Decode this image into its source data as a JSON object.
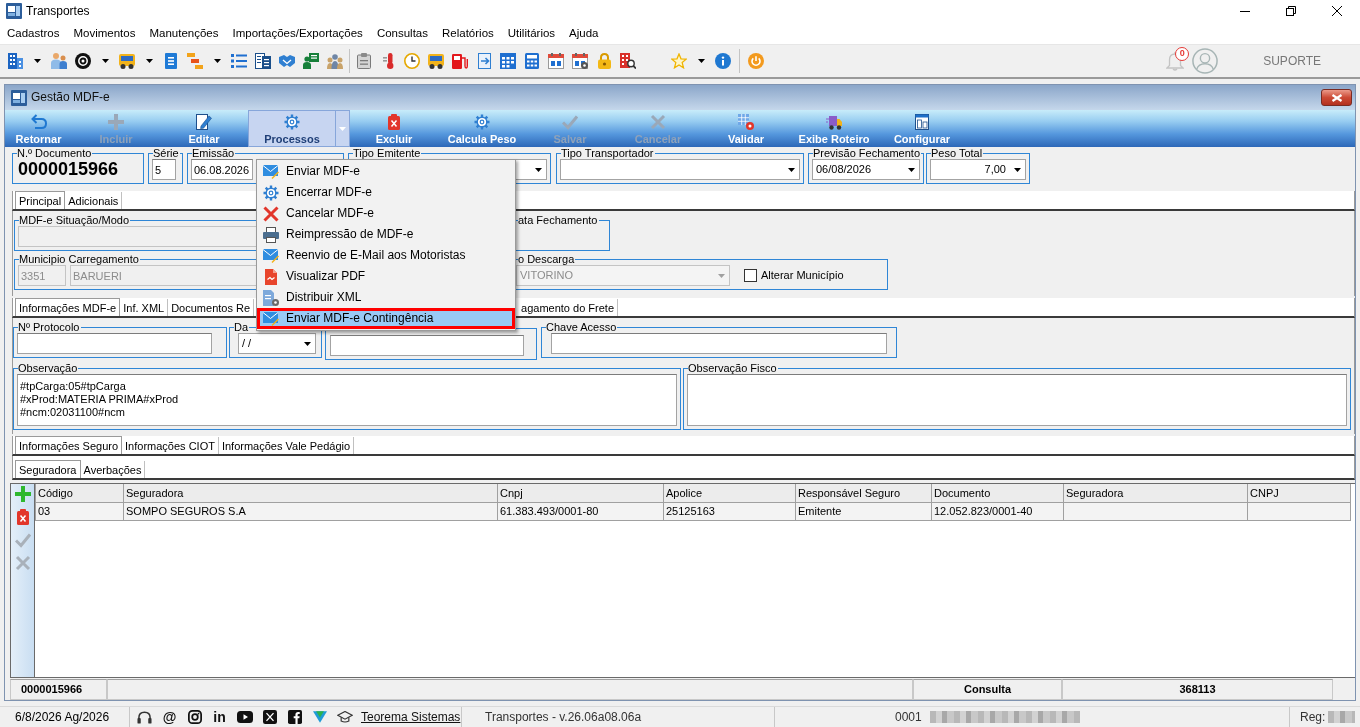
{
  "window": {
    "title": "Transportes"
  },
  "menu": [
    "Cadastros",
    "Movimentos",
    "Manutenções",
    "Importações/Exportações",
    "Consultas",
    "Relatórios",
    "Utilitários",
    "Ajuda"
  ],
  "header": {
    "notifications": "0",
    "user": "SUPORTE"
  },
  "form": {
    "title": "Gestão MDF-e"
  },
  "ribbon": [
    {
      "label": "Retornar",
      "selected": false,
      "disabled": false
    },
    {
      "label": "Incluir",
      "selected": false,
      "disabled": true
    },
    {
      "label": "Editar",
      "selected": false,
      "disabled": false
    },
    {
      "label": "Processos",
      "selected": true,
      "disabled": false,
      "dropdown": true
    },
    {
      "label": "Excluir",
      "selected": false,
      "disabled": false
    },
    {
      "label": "Calcula Peso",
      "selected": false,
      "disabled": false
    },
    {
      "label": "Salvar",
      "selected": false,
      "disabled": true
    },
    {
      "label": "Cancelar",
      "selected": false,
      "disabled": true
    },
    {
      "label": "Validar",
      "selected": false,
      "disabled": false
    },
    {
      "label": "Exibe Roteiro",
      "selected": false,
      "disabled": false
    },
    {
      "label": "Configurar",
      "selected": false,
      "disabled": false
    }
  ],
  "header_fields": [
    {
      "kind": "number",
      "label": "N.º Documento",
      "value": "0000015966"
    },
    {
      "kind": "input",
      "label": "Série",
      "value": "5"
    },
    {
      "kind": "input",
      "label": "Emissão",
      "value": "06.08.2026"
    },
    {
      "kind": "combo",
      "label": "Tipo Emitente"
    },
    {
      "kind": "combo",
      "label": "Tipo Transportador"
    },
    {
      "kind": "combo",
      "label": "Previsão Fechamento",
      "value": "06/08/2026"
    },
    {
      "kind": "combo",
      "label": "Peso Total",
      "value": "7,00"
    }
  ],
  "main_tabs": [
    {
      "label": "Principal",
      "selected": true
    },
    {
      "label": "Adicionais",
      "selected": false
    }
  ],
  "principal": {
    "situacao": {
      "label": "MDF-e Situação/Modo",
      "disabled": true
    },
    "fechamento": {
      "label": "ata Fechamento"
    },
    "carregamento": {
      "label": "Municipio Carregamento",
      "code": "3351",
      "city": "BARUERI",
      "disabled": true
    },
    "descarga": {
      "label": "o Descarga",
      "city": "VITORINO",
      "disabled": true,
      "alterar": {
        "label": "Alterar Município",
        "checked": false
      }
    }
  },
  "info_tabs": [
    {
      "label": "Informações MDF-e",
      "selected": true
    },
    {
      "label": "Inf. XML",
      "selected": false
    },
    {
      "label": "Documentos Re",
      "selected": false
    },
    {
      "label": "agamento do Frete",
      "selected": false
    }
  ],
  "info_fields": [
    {
      "kind": "input",
      "label": "Nº Protocolo"
    },
    {
      "kind": "combo",
      "label": "Da",
      "value": "/ /"
    },
    {
      "kind": "input"
    },
    {
      "kind": "input",
      "label": "Chave Acesso"
    }
  ],
  "notes": [
    {
      "label": "Observação",
      "lines": [
        "#tpCarga:05#tpCarga",
        "#xProd:MATERIA PRIMA#xProd",
        "#ncm:02031100#ncm"
      ]
    },
    {
      "label": "Observação Fisco"
    }
  ],
  "insurance_tabs": [
    {
      "label": "Informações Seguro",
      "selected": true
    },
    {
      "label": "Informações CIOT",
      "selected": false
    },
    {
      "label": "Informações Vale Pedágio",
      "selected": false
    }
  ],
  "insurance_subtabs": [
    {
      "label": "Seguradora",
      "selected": true
    },
    {
      "label": "Averbações",
      "selected": false
    }
  ],
  "grid_tools": [
    {
      "disabled": false
    },
    {
      "disabled": false
    },
    {
      "disabled": true
    },
    {
      "disabled": true
    }
  ],
  "grid": {
    "columns": [
      "Código",
      "Seguradora",
      "Cnpj",
      "Apolice",
      "Responsável Seguro",
      "Documento",
      "Seguradora",
      "CNPJ"
    ],
    "rows": [
      {
        "selected": true,
        "cells": [
          "03",
          "SOMPO SEGUROS S.A",
          "61.383.493/0001-80",
          "25125163",
          "Emitente",
          "12.052.823/0001-40"
        ]
      }
    ]
  },
  "status_bar": {
    "document": "0000015966",
    "mode": "Consulta",
    "code": "368113"
  },
  "footer": {
    "date": "6/8/2026 Ag/2026",
    "glyphs": [
      "@",
      "in"
    ],
    "link": "Teorema Sistemas",
    "version": "Transportes - v.26.06a08.06a",
    "company": "0001",
    "reg": "Reg:"
  },
  "process_menu": [
    {
      "label": "Enviar MDF-e",
      "selected": false,
      "outlined": false
    },
    {
      "label": "Encerrar MDF-e",
      "selected": false,
      "outlined": false
    },
    {
      "label": "Cancelar MDF-e",
      "selected": false,
      "outlined": false
    },
    {
      "label": "Reimpressão de MDF-e",
      "selected": false,
      "outlined": false
    },
    {
      "label": "Reenvio de E-Mail aos Motoristas",
      "selected": false,
      "outlined": false
    },
    {
      "label": "Visualizar PDF",
      "selected": false,
      "outlined": false
    },
    {
      "label": "Distribuir XML",
      "selected": false,
      "outlined": false
    },
    {
      "label": "Enviar MDF-e Contingência",
      "selected": true,
      "outlined": true
    }
  ]
}
